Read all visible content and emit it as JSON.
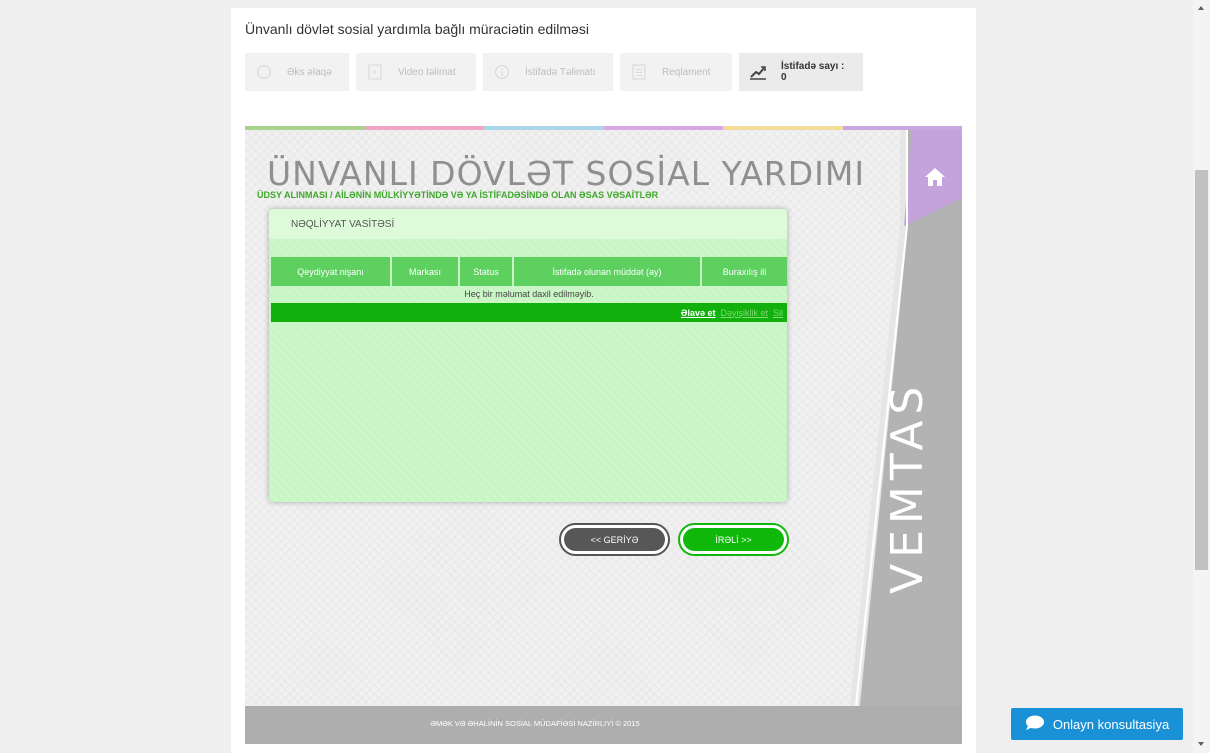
{
  "page": {
    "title": "Ünvanlı dövlət sosial yardımla bağlı müraciətin edilməsi"
  },
  "toolbar": {
    "buttons": [
      {
        "label": "Əks əlaqə",
        "icon": "circle-icon"
      },
      {
        "label": "Video təlimat",
        "icon": "document-play-icon"
      },
      {
        "label": "İstifadə Təlimatı",
        "icon": "info-icon"
      },
      {
        "label": "Reqlament",
        "icon": "document-list-icon"
      },
      {
        "label": "İstifadə sayı : 0",
        "icon": "chart-trend-icon"
      }
    ]
  },
  "app": {
    "title": "ÜNVANLI DÖVLƏT SOSİAL YARDIMI",
    "subtitle": "ÜDSY ALINMASI / AİLƏNİN MÜLKİYYƏTİNDƏ VƏ YA İSTİFADƏSİNDƏ OLAN ƏSAS VƏSAİTLƏR",
    "brand": "VEMTAS",
    "stripe_colors": [
      "#a8d28e",
      "#f2a5c5",
      "#a9d6e8",
      "#d7a8e2",
      "#f4dd98",
      "#c9a8e1"
    ],
    "accent_purple": "#c4a3dc",
    "green": "#11b00d",
    "light_green": "#c8f5c4"
  },
  "panel": {
    "title": "NƏQLİYYAT VASİTƏSİ",
    "columns": [
      "Qeydiyyat nişanı",
      "Markası",
      "Status",
      "İstifadə olunan müddət (ay)",
      "Buraxılış ili"
    ],
    "empty_text": "Heç bir məlumat daxil edilməyib.",
    "actions": {
      "add": "Əlavə et",
      "edit": "Dəyişiklik et",
      "delete": "Sil"
    }
  },
  "nav": {
    "back": "<< GERİYƏ",
    "next": "İRƏLİ >>"
  },
  "footer": {
    "text": "ƏMƏK VƏ ƏHALİNİN SOSİAL MÜDAFİƏSİ NAZİRLİYİ © 2015"
  },
  "chat": {
    "label": "Onlayn konsultasiya"
  }
}
